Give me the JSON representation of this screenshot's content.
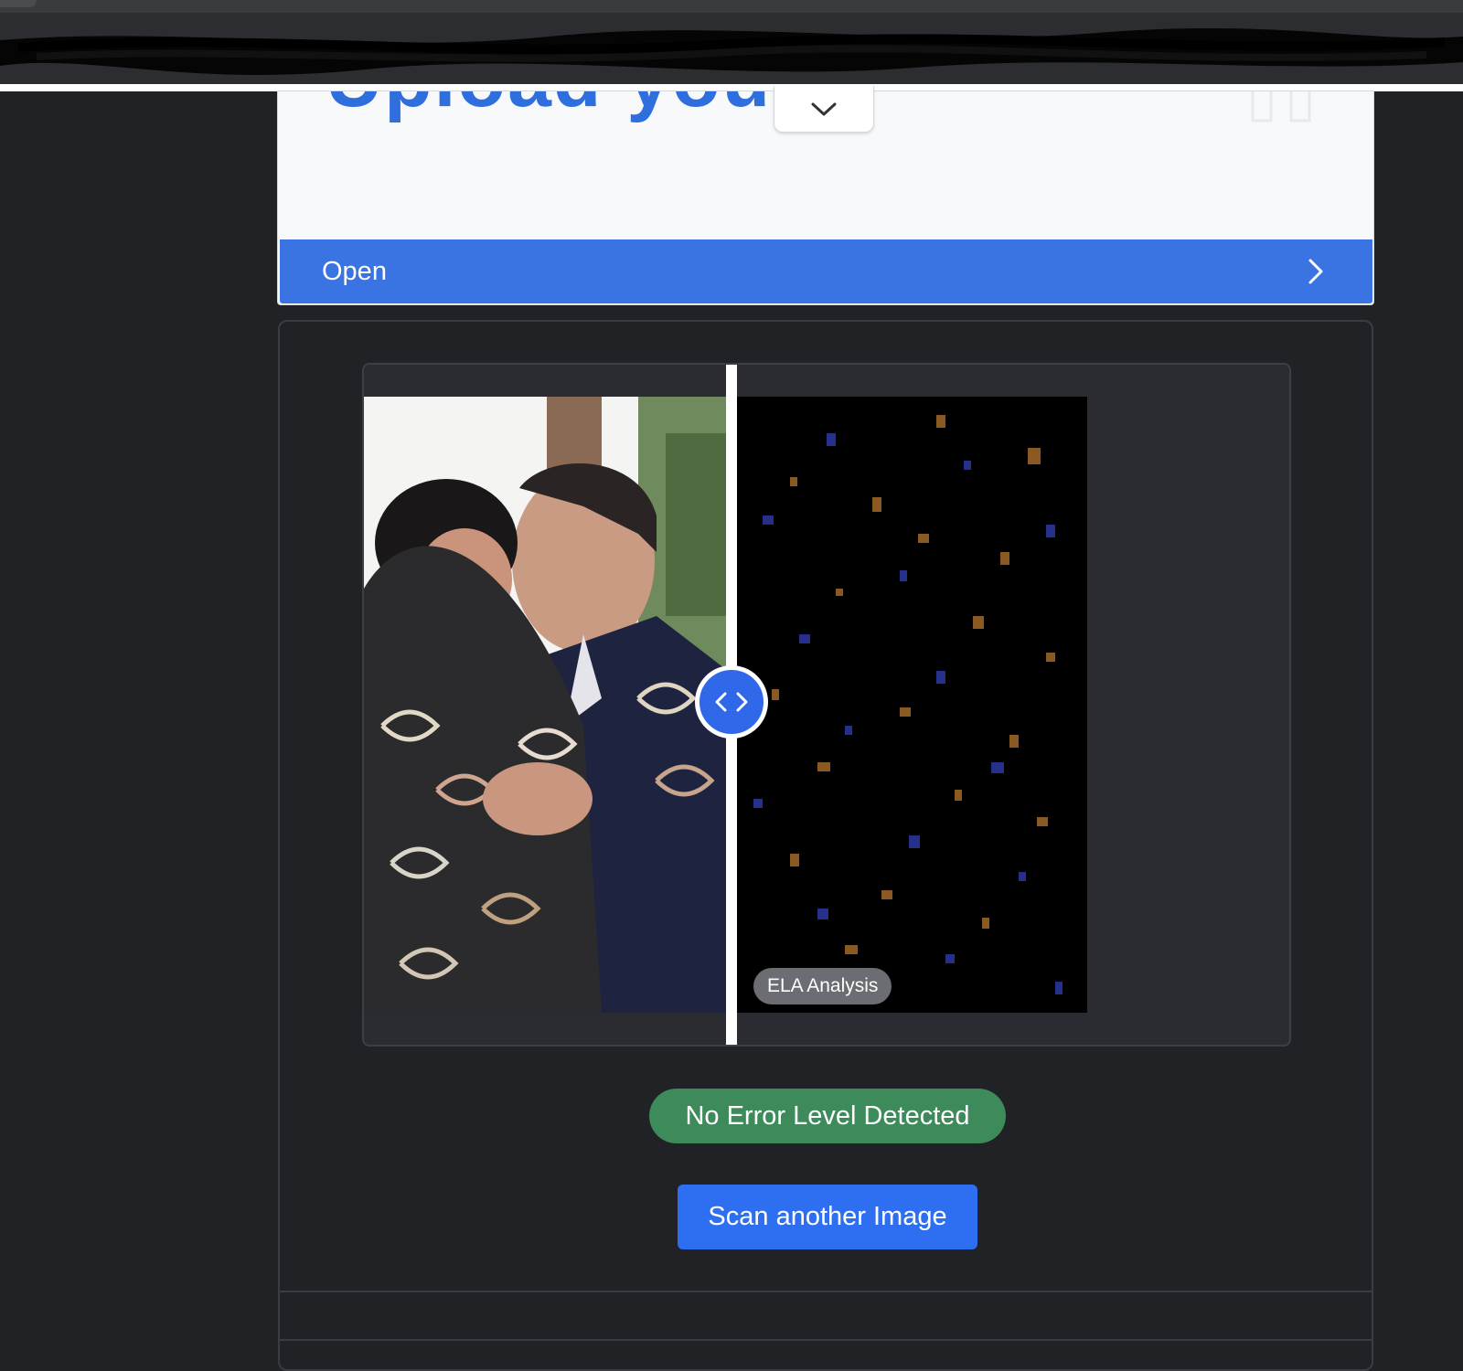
{
  "banner": {
    "title_fragment": "Upload your",
    "open_label": "Open"
  },
  "comparison": {
    "overlay_label": "ELA Analysis",
    "divider_position_fraction": 0.39
  },
  "result": {
    "status_text": "No Error Level Detected",
    "status_color": "#3d8a5a"
  },
  "actions": {
    "scan_another_label": "Scan another Image"
  },
  "colors": {
    "accent": "#3a73e2",
    "button": "#2e6ff2",
    "page_background": "#202226"
  }
}
